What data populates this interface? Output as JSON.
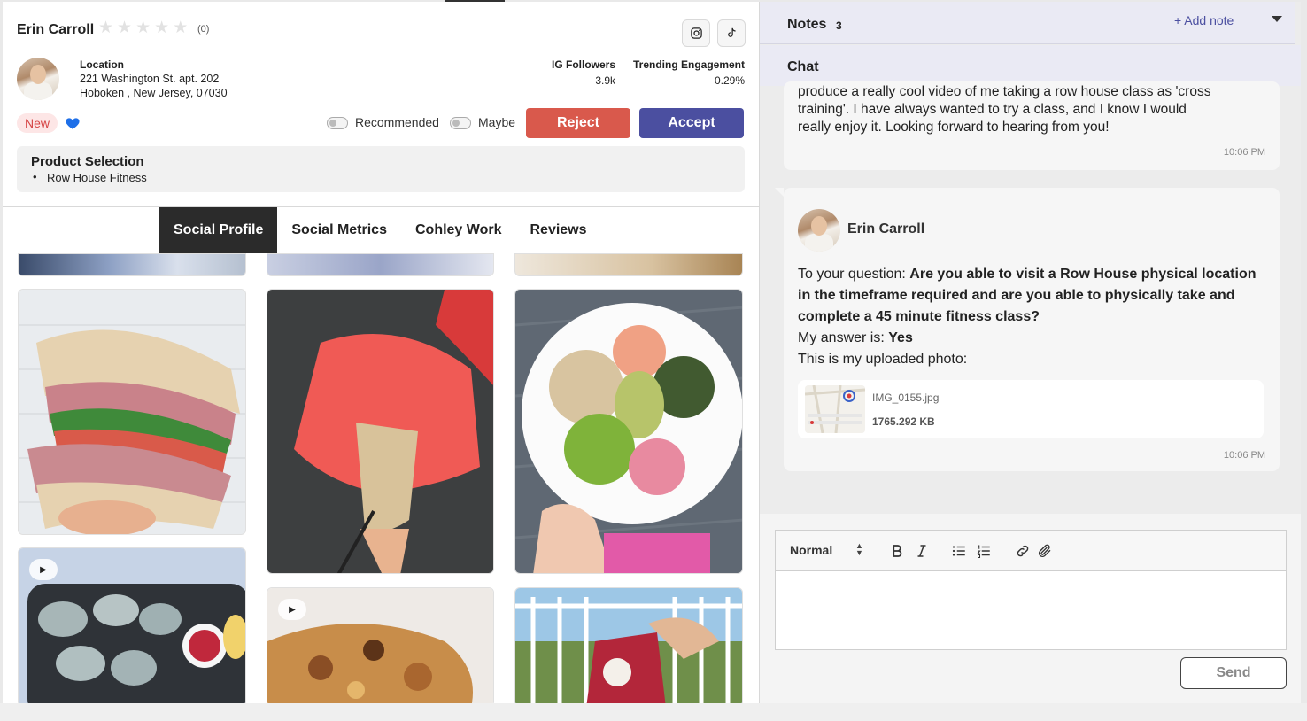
{
  "profile": {
    "name": "Erin Carroll",
    "rating_count": "(0)",
    "location_label": "Location",
    "address_line1": "221 Washington St. apt. 202",
    "address_line2": "Hoboken , New Jersey, 07030",
    "ig_followers_label": "IG Followers",
    "ig_followers_value": "3.9k",
    "engagement_label": "Trending Engagement",
    "engagement_value": "0.29%",
    "status_badge": "New",
    "recommended_label": "Recommended",
    "maybe_label": "Maybe",
    "reject_label": "Reject",
    "accept_label": "Accept",
    "rating": 0
  },
  "product": {
    "title": "Product Selection",
    "items": [
      "Row House Fitness"
    ]
  },
  "tabs": [
    {
      "label": "Social Profile",
      "active": true
    },
    {
      "label": "Social Metrics",
      "active": false
    },
    {
      "label": "Cohley Work",
      "active": false
    },
    {
      "label": "Reviews",
      "active": false
    }
  ],
  "notes": {
    "title": "Notes",
    "count": "3",
    "add_label": "+ Add note"
  },
  "chat": {
    "title": "Chat",
    "message1": {
      "lines": [
        "produce a really cool video of me taking a row house class as 'cross",
        "training'. I have always wanted to try a class, and I know I would",
        "really enjoy it. Looking forward to hearing from you!"
      ],
      "time": "10:06 PM"
    },
    "message2": {
      "sender": "Erin Carroll",
      "question_prefix": "To your question: ",
      "question_lines": [
        "Are you able to visit a Row House physical location",
        "in the timeframe required and are you able to physically take and",
        "complete a 45 minute fitness class?"
      ],
      "answer_prefix": "My answer is: ",
      "answer": "Yes",
      "photo_text": "This is my uploaded photo:",
      "attachment_name": "IMG_0155.jpg",
      "attachment_size": "1765.292 KB",
      "time": "10:06 PM"
    }
  },
  "composer": {
    "format": "Normal",
    "send_label": "Send"
  },
  "colors": {
    "reject": "#d9594c",
    "accept": "#4b4fa0",
    "active_tab": "#2b2b2b",
    "heart": "#1e6fe8"
  }
}
